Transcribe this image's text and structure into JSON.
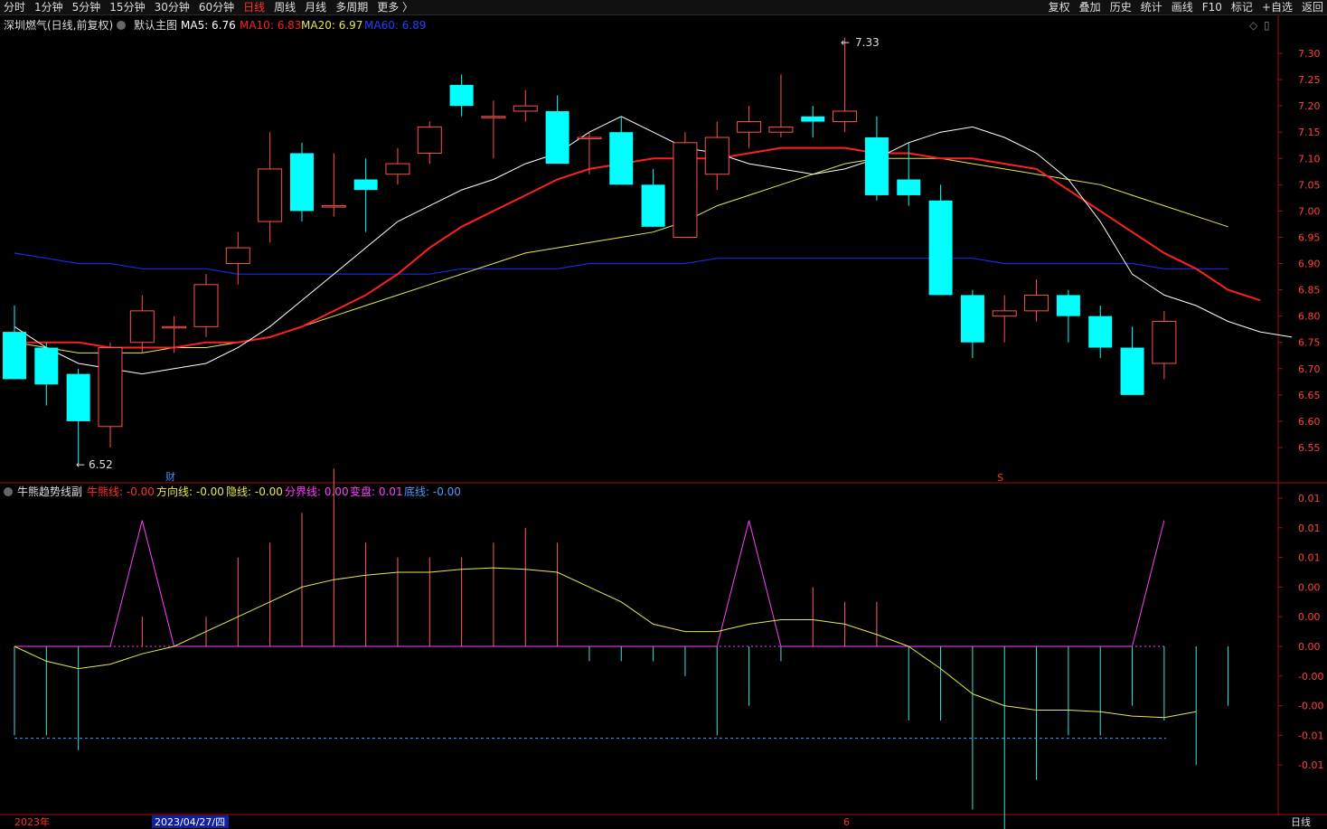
{
  "toolbar": {
    "left": [
      "分时",
      "1分钟",
      "5分钟",
      "15分钟",
      "30分钟",
      "60分钟",
      "日线",
      "周线",
      "月线",
      "多周期",
      "更多 〉"
    ],
    "active": "日线",
    "right": [
      "复权",
      "叠加",
      "历史",
      "统计",
      "画线",
      "F10",
      "标记",
      "+自选",
      "返回"
    ]
  },
  "main_header": {
    "stock": "深圳燃气(日线,前复权)",
    "chart_name": "默认主图",
    "ma5": "MA5: 6.76",
    "ma10": "MA10: 6.83",
    "ma20": "MA20: 6.97",
    "ma60": "MA60: 6.89"
  },
  "sub_header": {
    "name": "牛熊趋势线副",
    "l1": "牛熊线: -0.00",
    "l2": "方向线: -0.00",
    "l3": "隐线: -0.00",
    "l4": "分界线: 0.00",
    "l5": "变盘: 0.01",
    "l6": "底线: -0.00"
  },
  "annotations": {
    "high": "7.33",
    "low": "6.52",
    "fin_mark": "财",
    "s_mark": "S"
  },
  "bottom": {
    "year": "2023年",
    "date": "2023/04/27/四",
    "month": "6",
    "period": "日线"
  },
  "colors": {
    "up": "#ff5050",
    "down": "#00ffff",
    "ma5": "#ffffff",
    "ma10": "#ff2020",
    "ma20": "#e8e850",
    "ma60": "#1a2ae0",
    "divider": "#ff40ff",
    "bg": "#000000"
  },
  "chart_data": {
    "type": "candlestick",
    "y_ticks_main": [
      "7.30",
      "7.25",
      "7.20",
      "7.15",
      "7.10",
      "7.05",
      "7.00",
      "6.95",
      "6.90",
      "6.85",
      "6.80",
      "6.75",
      "6.70",
      "6.65",
      "6.60",
      "6.55"
    ],
    "y_ticks_sub": [
      "0.01",
      "0.01",
      "0.01",
      "0.00",
      "0.00",
      "0.00",
      "-0.00",
      "-0.00",
      "-0.01",
      "-0.01"
    ],
    "candles": [
      {
        "o": 6.77,
        "h": 6.82,
        "l": 6.68,
        "c": 6.68
      },
      {
        "o": 6.74,
        "h": 6.75,
        "l": 6.63,
        "c": 6.67
      },
      {
        "o": 6.69,
        "h": 6.7,
        "l": 6.52,
        "c": 6.6
      },
      {
        "o": 6.59,
        "h": 6.75,
        "l": 6.55,
        "c": 6.74
      },
      {
        "o": 6.75,
        "h": 6.84,
        "l": 6.73,
        "c": 6.81
      },
      {
        "o": 6.78,
        "h": 6.8,
        "l": 6.73,
        "c": 6.78
      },
      {
        "o": 6.78,
        "h": 6.88,
        "l": 6.76,
        "c": 6.86
      },
      {
        "o": 6.9,
        "h": 6.96,
        "l": 6.86,
        "c": 6.93
      },
      {
        "o": 6.98,
        "h": 7.15,
        "l": 6.94,
        "c": 7.08
      },
      {
        "o": 7.11,
        "h": 7.13,
        "l": 6.98,
        "c": 7.0
      },
      {
        "o": 7.01,
        "h": 7.11,
        "l": 6.99,
        "c": 7.01
      },
      {
        "o": 7.06,
        "h": 7.1,
        "l": 6.96,
        "c": 7.04
      },
      {
        "o": 7.07,
        "h": 7.12,
        "l": 7.05,
        "c": 7.09
      },
      {
        "o": 7.11,
        "h": 7.17,
        "l": 7.09,
        "c": 7.16
      },
      {
        "o": 7.24,
        "h": 7.26,
        "l": 7.18,
        "c": 7.2
      },
      {
        "o": 7.18,
        "h": 7.21,
        "l": 7.1,
        "c": 7.18
      },
      {
        "o": 7.19,
        "h": 7.23,
        "l": 7.17,
        "c": 7.2
      },
      {
        "o": 7.19,
        "h": 7.22,
        "l": 7.09,
        "c": 7.09
      },
      {
        "o": 7.14,
        "h": 7.15,
        "l": 7.07,
        "c": 7.14
      },
      {
        "o": 7.15,
        "h": 7.18,
        "l": 7.06,
        "c": 7.05
      },
      {
        "o": 7.05,
        "h": 7.08,
        "l": 6.97,
        "c": 6.97
      },
      {
        "o": 6.95,
        "h": 7.15,
        "l": 6.95,
        "c": 7.13
      },
      {
        "o": 7.07,
        "h": 7.17,
        "l": 7.04,
        "c": 7.14
      },
      {
        "o": 7.15,
        "h": 7.2,
        "l": 7.12,
        "c": 7.17
      },
      {
        "o": 7.15,
        "h": 7.26,
        "l": 7.14,
        "c": 7.16
      },
      {
        "o": 7.18,
        "h": 7.2,
        "l": 7.14,
        "c": 7.17
      },
      {
        "o": 7.17,
        "h": 7.33,
        "l": 7.15,
        "c": 7.19
      },
      {
        "o": 7.14,
        "h": 7.18,
        "l": 7.02,
        "c": 7.03
      },
      {
        "o": 7.06,
        "h": 7.13,
        "l": 7.01,
        "c": 7.03
      },
      {
        "o": 7.02,
        "h": 7.05,
        "l": 6.84,
        "c": 6.84
      },
      {
        "o": 6.84,
        "h": 6.85,
        "l": 6.72,
        "c": 6.75
      },
      {
        "o": 6.8,
        "h": 6.84,
        "l": 6.75,
        "c": 6.81
      },
      {
        "o": 6.81,
        "h": 6.87,
        "l": 6.79,
        "c": 6.84
      },
      {
        "o": 6.84,
        "h": 6.85,
        "l": 6.75,
        "c": 6.8
      },
      {
        "o": 6.8,
        "h": 6.82,
        "l": 6.72,
        "c": 6.74
      },
      {
        "o": 6.74,
        "h": 6.78,
        "l": 6.65,
        "c": 6.65
      },
      {
        "o": 6.71,
        "h": 6.81,
        "l": 6.68,
        "c": 6.79
      }
    ],
    "ma5": [
      6.78,
      6.74,
      6.71,
      6.7,
      6.69,
      6.7,
      6.71,
      6.74,
      6.78,
      6.83,
      6.88,
      6.93,
      6.98,
      7.01,
      7.04,
      7.06,
      7.09,
      7.11,
      7.15,
      7.18,
      7.15,
      7.12,
      7.11,
      7.09,
      7.08,
      7.07,
      7.08,
      7.1,
      7.13,
      7.15,
      7.16,
      7.14,
      7.11,
      7.06,
      6.98,
      6.88,
      6.84,
      6.82,
      6.79,
      6.77,
      6.76
    ],
    "ma10": [
      6.75,
      6.75,
      6.75,
      6.74,
      6.74,
      6.74,
      6.75,
      6.75,
      6.76,
      6.78,
      6.81,
      6.84,
      6.88,
      6.93,
      6.97,
      7.0,
      7.03,
      7.06,
      7.08,
      7.09,
      7.1,
      7.1,
      7.1,
      7.11,
      7.12,
      7.12,
      7.12,
      7.11,
      7.11,
      7.1,
      7.1,
      7.09,
      7.08,
      7.04,
      7.0,
      6.96,
      6.92,
      6.89,
      6.85,
      6.83
    ],
    "ma20": [
      6.75,
      6.74,
      6.73,
      6.73,
      6.73,
      6.74,
      6.74,
      6.75,
      6.76,
      6.78,
      6.8,
      6.82,
      6.84,
      6.86,
      6.88,
      6.9,
      6.92,
      6.93,
      6.94,
      6.95,
      6.96,
      6.98,
      7.01,
      7.03,
      7.05,
      7.07,
      7.09,
      7.1,
      7.1,
      7.1,
      7.09,
      7.08,
      7.07,
      7.06,
      7.05,
      7.03,
      7.01,
      6.99,
      6.97
    ],
    "ma60": [
      6.92,
      6.91,
      6.9,
      6.9,
      6.89,
      6.89,
      6.89,
      6.88,
      6.88,
      6.88,
      6.88,
      6.88,
      6.88,
      6.88,
      6.89,
      6.89,
      6.89,
      6.89,
      6.9,
      6.9,
      6.9,
      6.9,
      6.91,
      6.91,
      6.91,
      6.91,
      6.91,
      6.91,
      6.91,
      6.91,
      6.91,
      6.9,
      6.9,
      6.9,
      6.9,
      6.9,
      6.89,
      6.89,
      6.89
    ],
    "sub": {
      "bars": [
        -0.006,
        -0.006,
        -0.007,
        0.0,
        0.002,
        0.0,
        0.002,
        0.006,
        0.007,
        0.009,
        0.012,
        0.007,
        0.006,
        0.006,
        0.006,
        0.007,
        0.008,
        0.007,
        -0.001,
        -0.001,
        -0.001,
        -0.002,
        -0.006,
        -0.004,
        -0.001,
        0.004,
        0.003,
        0.003,
        -0.005,
        -0.005,
        -0.011,
        -0.013,
        -0.009,
        -0.006,
        -0.006,
        -0.004,
        -0.005,
        -0.008,
        -0.004
      ],
      "direction": [
        0.0,
        -0.001,
        -0.0015,
        -0.0012,
        -0.0005,
        0.0,
        0.001,
        0.002,
        0.003,
        0.004,
        0.0045,
        0.0048,
        0.005,
        0.005,
        0.0052,
        0.0053,
        0.0052,
        0.005,
        0.004,
        0.003,
        0.0015,
        0.001,
        0.001,
        0.0015,
        0.0018,
        0.0018,
        0.0015,
        0.0008,
        0.0,
        -0.0015,
        -0.0032,
        -0.004,
        -0.0043,
        -0.0043,
        -0.0044,
        -0.0047,
        -0.0048,
        -0.0044
      ],
      "divider": [
        0,
        0,
        0,
        0,
        0.0085,
        0,
        0,
        0,
        0,
        0,
        0,
        0,
        0,
        0,
        0,
        0,
        0,
        0,
        0,
        0,
        0,
        0,
        0,
        0.0085,
        0,
        0,
        0,
        0,
        0,
        0,
        0,
        0,
        0,
        0,
        0,
        0,
        0.0085
      ],
      "bottom_level": -0.0062
    }
  }
}
